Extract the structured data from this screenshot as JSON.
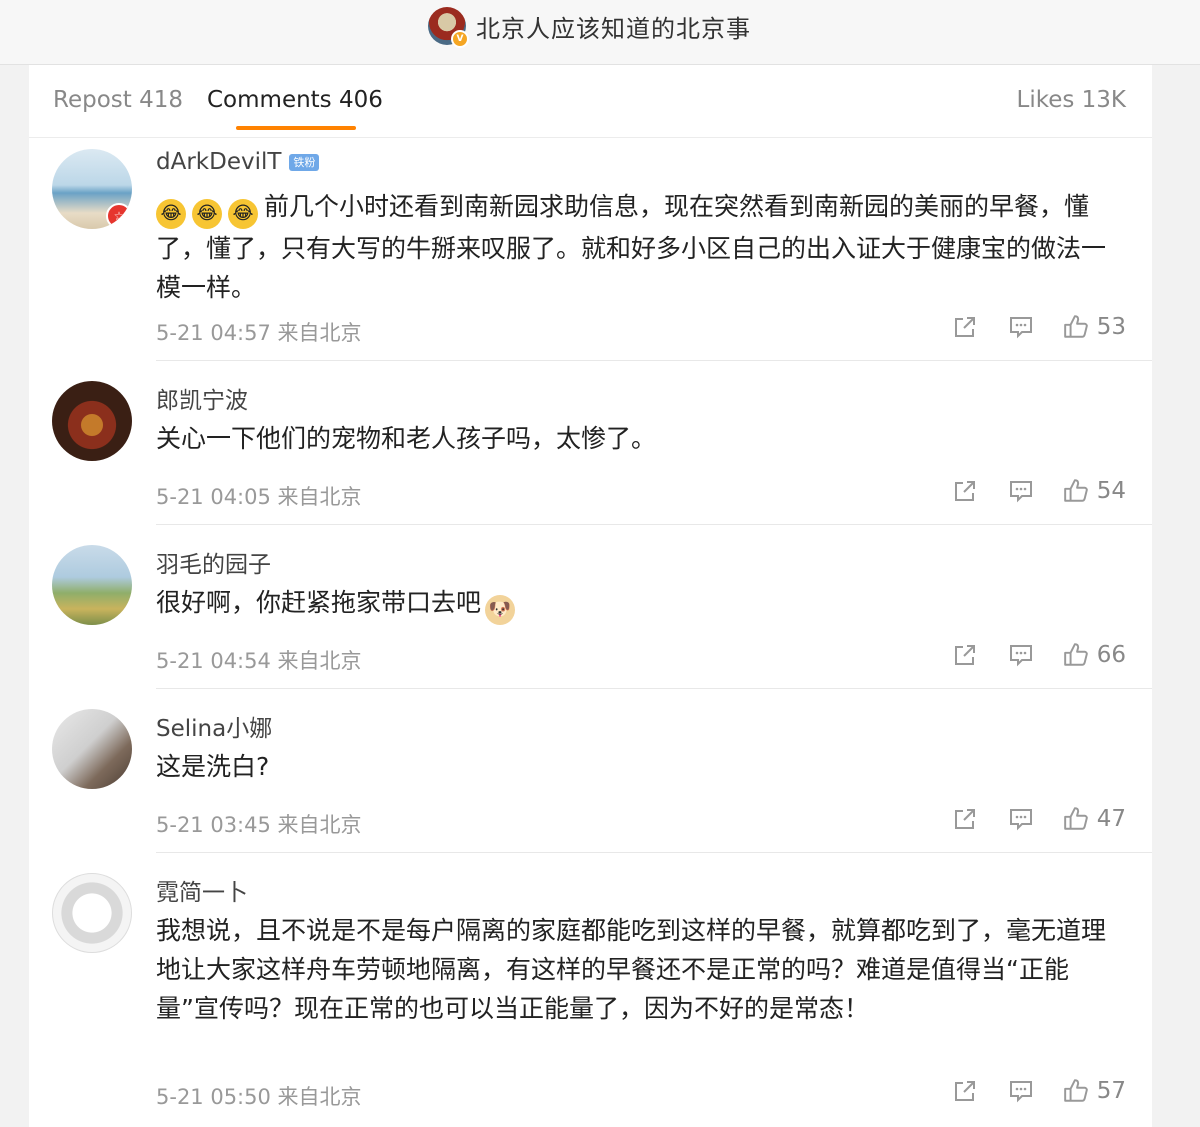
{
  "header": {
    "title": "北京人应该知道的北京事",
    "avatar_badge": "V"
  },
  "tabs": {
    "repost": "Repost 418",
    "comments": "Comments 406",
    "likes": "Likes 13K"
  },
  "colors": {
    "accent": "#ff8200",
    "fan_badge": "#6fa8e8"
  },
  "comments": [
    {
      "name": "dArkDevilT",
      "badge": "铁粉",
      "text": "前几个小时还看到南新园求助信息，现在突然看到南新园的美丽的早餐，懂了，懂了，只有大写的牛掰来叹服了。就和好多小区自己的出入证大于健康宝的做法一模一样。",
      "emoji_prefix": [
        "😂",
        "😂",
        "😂"
      ],
      "time": "5-21 04:57 来自北京",
      "likes": "53"
    },
    {
      "name": "郎凯宁波",
      "text": "关心一下他们的宠物和老人孩子吗，太惨了。",
      "time": "5-21 04:05 来自北京",
      "likes": "54"
    },
    {
      "name": "羽毛的园子",
      "text": "很好啊，你赶紧拖家带口去吧",
      "emoji_suffix": "🐶",
      "time": "5-21 04:54 来自北京",
      "likes": "66"
    },
    {
      "name": "Selina小娜",
      "text": "这是洗白?",
      "time": "5-21 03:45 来自北京",
      "likes": "47"
    },
    {
      "name": "霓简一卜",
      "text": "我想说，且不说是不是每户隔离的家庭都能吃到这样的早餐，就算都吃到了，毫无道理地让大家这样舟车劳顿地隔离，有这样的早餐还不是正常的吗？难道是值得当“正能量”宣传吗？现在正常的也可以当正能量了，因为不好的是常态！",
      "time": "5-21 05:50 来自北京",
      "likes": "57"
    }
  ],
  "icons": {
    "share": "share-icon",
    "comment": "comment-icon",
    "like": "thumbs-up-icon"
  }
}
